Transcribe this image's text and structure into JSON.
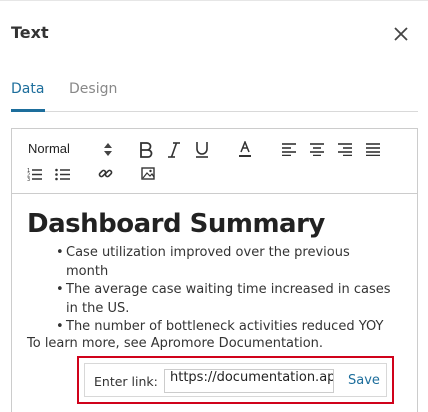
{
  "panel": {
    "title": "Text",
    "close_icon": "close-icon"
  },
  "tabs": [
    {
      "label": "Data",
      "active": true
    },
    {
      "label": "Design",
      "active": false
    }
  ],
  "toolbar": {
    "format_value": "Normal",
    "format_options": [
      "Normal"
    ],
    "buttons": [
      "bold-icon",
      "italic-icon",
      "underline-icon",
      "text-color-icon",
      "align-left-icon",
      "align-center-icon",
      "align-right-icon",
      "align-justify-icon",
      "ordered-list-icon",
      "bullet-list-icon",
      "link-icon",
      "image-icon"
    ]
  },
  "content": {
    "heading": "Dashboard Summary",
    "bullets": [
      "Case utilization improved over the previous month",
      "The average case waiting time increased in cases in the US.",
      "The number of bottleneck activities reduced YOY"
    ],
    "learn_more": "To learn more, see Apromore Documentation."
  },
  "link_popup": {
    "label": "Enter link:",
    "value": "https://documentation.apromore.org",
    "save_label": "Save",
    "highlight_color": "#d0021b"
  },
  "colors": {
    "accent": "#1d6e9c"
  }
}
